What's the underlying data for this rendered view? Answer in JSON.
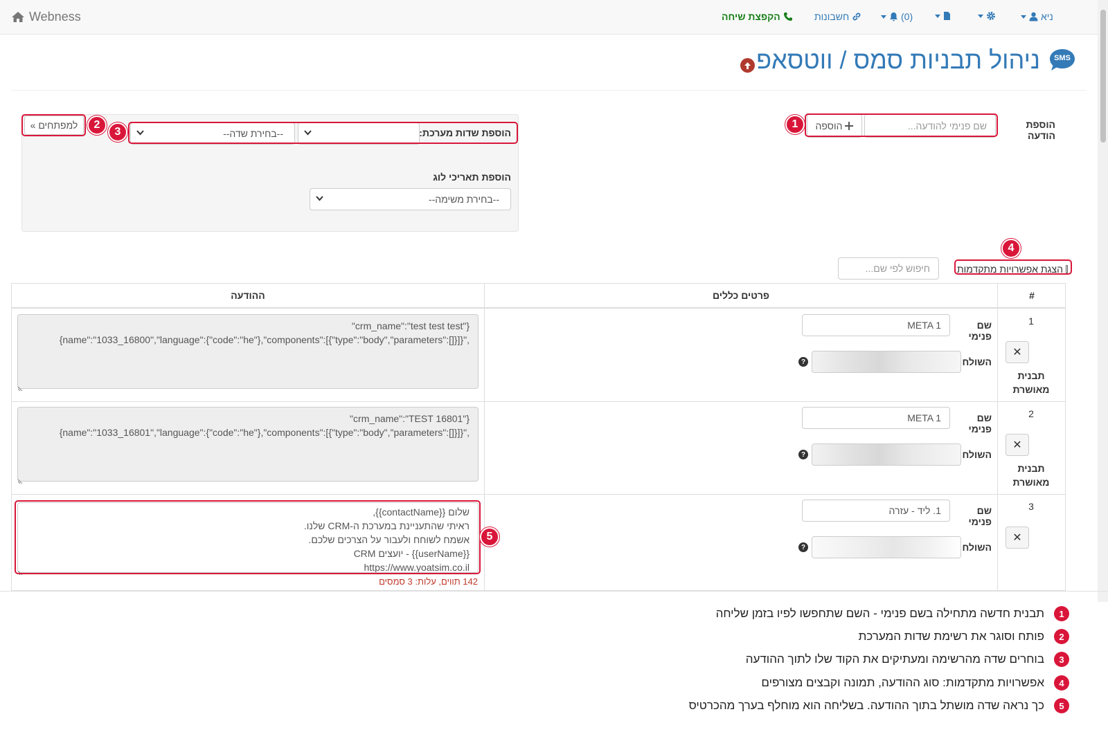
{
  "navbar": {
    "brand": "Webness",
    "call_jump": "הקפצת שיחה",
    "accounts": "חשבונות",
    "notifications": "(0)",
    "user": "ניא"
  },
  "page": {
    "title": "ניהול תבניות סמס / ווטסאפ",
    "sms_badge": "SMS"
  },
  "add_message": {
    "label": "הוספת הודעה",
    "placeholder": "שם פנימי להודעה...",
    "add_button": "הוספה"
  },
  "fields_panel": {
    "toggle_button": "למפתחים »",
    "system_fields_label": "הוספת שדות מערכת:",
    "field_select_value": "--בחירת שדה--",
    "log_dates_label": "הוספת תאריכי לוג",
    "task_select_value": "--בחירת משימה--"
  },
  "advanced": {
    "label": "הצגת אפשרויות מתקדמות",
    "checked": false
  },
  "search": {
    "placeholder": "חיפוש לפי שם..."
  },
  "table": {
    "headers": [
      "#",
      "פרטים כללים",
      "ההודעה"
    ],
    "internal_name_label": "שם פנימי",
    "sender_label": "השולח",
    "rows": [
      {
        "num": "1",
        "internal_name": "META 1",
        "status": "תבנית מאושרת",
        "message": "{\"crm_name\":\"test test test\"\n,\"{name\":\"1033_16800\",\"language\":{\"code\":\"he\"},\"components\":[{\"type\":\"body\",\"parameters\":[]}]}"
      },
      {
        "num": "2",
        "internal_name": "META 1",
        "status": "תבנית מאושרת",
        "message": "{\"crm_name\":\"TEST 16801\"\n,\"{name\":\"1033_16801\",\"language\":{\"code\":\"he\"},\"components\":[{\"type\":\"body\",\"parameters\":[]}]}"
      },
      {
        "num": "3",
        "internal_name": "1. ליד - עזרה",
        "status": "",
        "message": "שלום {{contactName}},\nראיתי שהתעניינת במערכת ה-CRM שלנו.\nאשמח לשוחח ולעבור על הצרכים שלכם.\n{{userName}} - יועצים CRM\nhttps://www.yoatsim.co.il",
        "char_count": "142 תווים, עלות: 3 סמסים"
      }
    ]
  },
  "callouts": [
    "1",
    "2",
    "3",
    "4",
    "5"
  ],
  "legend": [
    {
      "num": "1",
      "text": "תבנית חדשה מתחילה בשם פנימי - השם שתחפשו לפיו בזמן שליחה"
    },
    {
      "num": "2",
      "text": "פותח וסוגר את רשימת שדות המערכת"
    },
    {
      "num": "3",
      "text": "בוחרים שדה מהרשימה ומעתיקים את הקוד שלו לתוך ההודעה"
    },
    {
      "num": "4",
      "text": "אפשרויות מתקדמות: סוג ההודעה, תמונה וקבצים מצורפים"
    },
    {
      "num": "5",
      "text": "כך נראה שדה מושתל בתוך ההודעה. בשליחה הוא מוחלף בערך מהכרטיס"
    }
  ],
  "colors": {
    "primary": "#337ab7",
    "callout": "#d9163a",
    "call_jump": "#1a7f1a",
    "char_count": "#c0392b"
  }
}
